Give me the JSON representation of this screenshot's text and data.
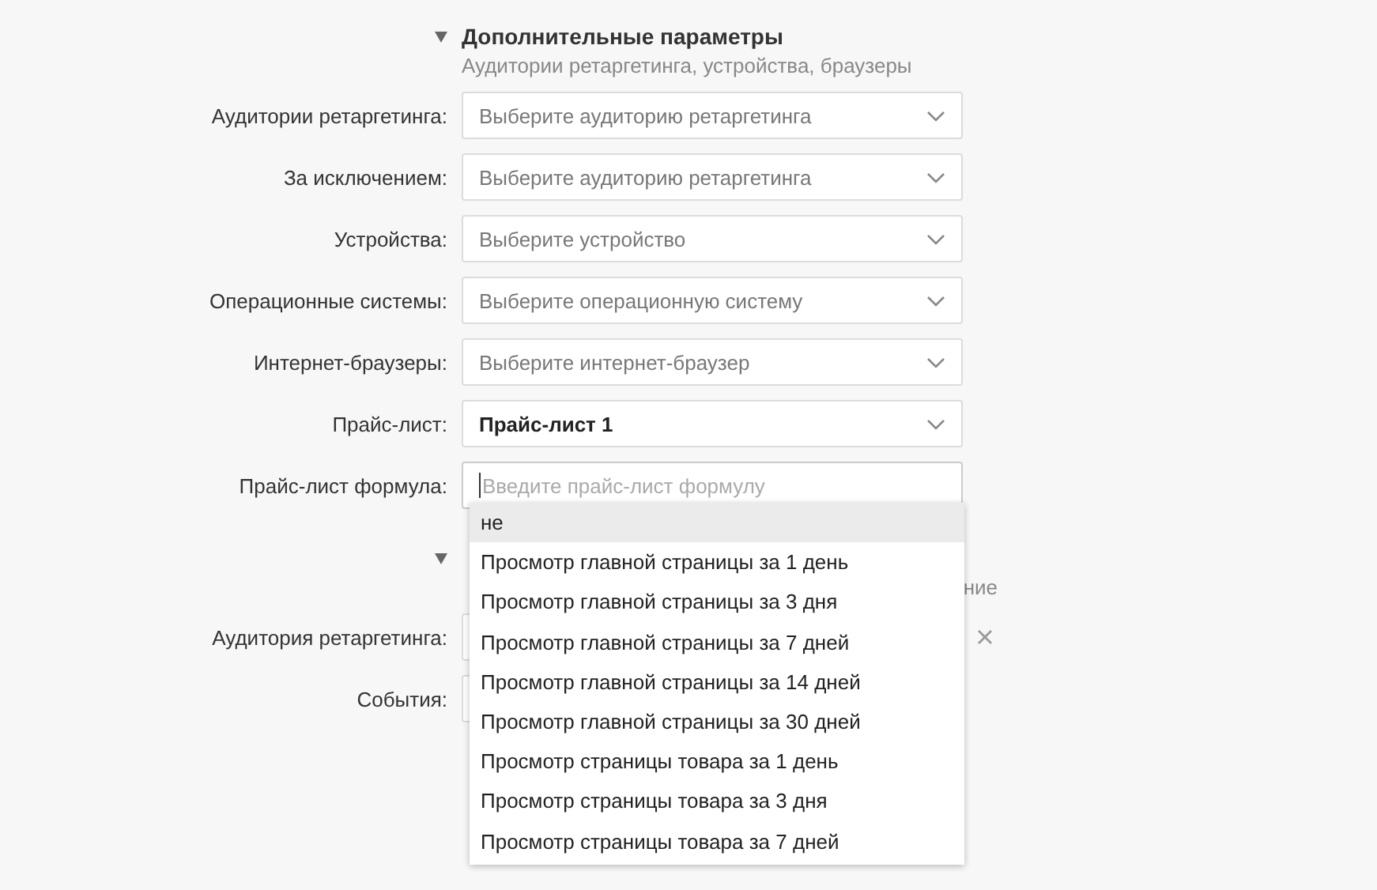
{
  "section": {
    "expanded": true,
    "title": "Дополнительные параметры",
    "subtitle": "Аудитории ретаргетинга, устройства, браузеры"
  },
  "fields": [
    {
      "label": "Аудитории ретаргетинга:",
      "kind": "select",
      "placeholder": "Выберите аудиторию ретаргетинга"
    },
    {
      "label": "За исключением:",
      "kind": "select",
      "placeholder": "Выберите аудиторию ретаргетинга"
    },
    {
      "label": "Устройства:",
      "kind": "select",
      "placeholder": "Выберите устройство"
    },
    {
      "label": "Операционные системы:",
      "kind": "select",
      "placeholder": "Выберите операционную систему"
    },
    {
      "label": "Интернет-браузеры:",
      "kind": "select",
      "placeholder": "Выберите интернет-браузер"
    },
    {
      "label": "Прайс-лист:",
      "kind": "select",
      "value": "Прайс-лист 1"
    },
    {
      "label": "Прайс-лист формула:",
      "kind": "text",
      "placeholder": "Введите прайс-лист формулу",
      "focused": true
    }
  ],
  "dropdown": {
    "options": [
      {
        "label": "не",
        "selected": true
      },
      {
        "label": "Просмотр главной страницы за 1 день",
        "selected": false
      },
      {
        "label": "Просмотр главной страницы за 3 дня",
        "selected": false
      },
      {
        "label": "Просмотр главной страницы за 7 дней",
        "selected": false
      },
      {
        "label": "Просмотр главной страницы за 14 дней",
        "selected": false
      },
      {
        "label": "Просмотр главной страницы за 30 дней",
        "selected": false
      },
      {
        "label": "Просмотр страницы товара за 1 день",
        "selected": false
      },
      {
        "label": "Просмотр страницы товара за 3 дня",
        "selected": false
      },
      {
        "label": "Просмотр страницы товара за 7 дней",
        "selected": false
      }
    ]
  },
  "section_2": {
    "expanded": true,
    "subtitle_end": "ние",
    "fields": [
      {
        "label": "Аудитория ретаргетинга:",
        "clearable": true
      },
      {
        "label": "События:",
        "clearable": false
      }
    ]
  }
}
